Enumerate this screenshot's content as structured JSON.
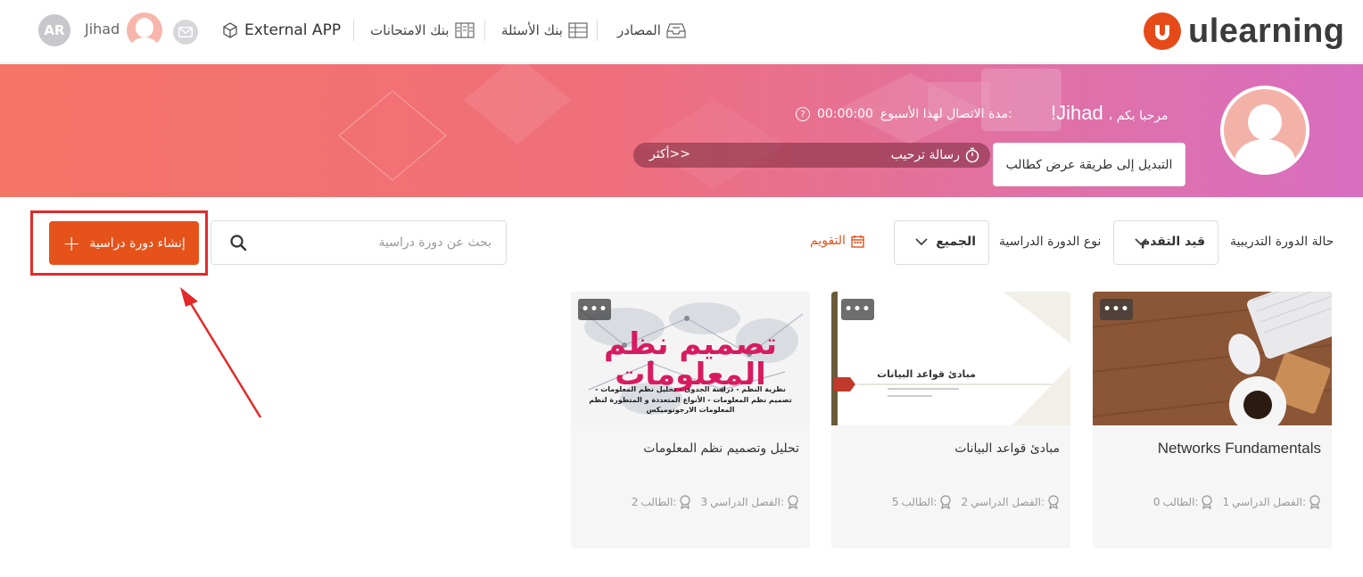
{
  "header": {
    "avatar_initials": "AR",
    "user_name": "Jihad",
    "nav": {
      "external_app": "External APP",
      "exam_bank": "بنك الامتحانات",
      "question_bank": "بنك الأسئلة",
      "resources": "المصادر"
    },
    "logo_text": "ulearning",
    "brand_color": "#e64a19"
  },
  "banner": {
    "greeting": "مرحبا بكم ،",
    "user_name": "Jihad!",
    "online_label": "مدة الاتصال لهذا الأسبوع:",
    "online_time": "00:00:00",
    "welcome_message": "رسالة ترحيب",
    "more_link": "أكثر>>",
    "switch_view_button": "التبديل إلى طريقة عرض كطالب"
  },
  "filters": {
    "create_course_button": "إنشاء دورة دراسية",
    "search_placeholder": "بحث عن دورة دراسية",
    "calendar_link": "التقويم",
    "course_type_label": "نوع الدورة الدراسية",
    "course_type_value": "الجميع",
    "status_label": "حالة الدورة التدريبية",
    "status_value": "قيد التقدم",
    "accent_color": "#e5531b"
  },
  "courses": [
    {
      "title": "Networks Fundamentals",
      "semester_label": "الفصل الدراسي:",
      "semester_value": "1",
      "students_label": "الطالب:",
      "students_value": "0"
    },
    {
      "title": "مبادئ قواعد البيانات",
      "semester_label": "الفصل الدراسي:",
      "semester_value": "2",
      "students_label": "الطالب:",
      "students_value": "5",
      "thumb_title": "مبادئ قواعد البيانات"
    },
    {
      "title": "تحليل وتصميم نظم المعلومات",
      "semester_label": "الفصل الدراسي:",
      "semester_value": "3",
      "students_label": "الطالب:",
      "students_value": "2",
      "thumb_title": "تصميم نظم المعلومات",
      "thumb_subtitle": "نظرية النظم - دراسة الجدوى - تحليل نظم المعلومات - تصميم نظم المعلومات - الأنواع المتعددة و المتطورة لنظم المعلومات الارجونوميكس"
    }
  ],
  "card_menu_label": "•••"
}
